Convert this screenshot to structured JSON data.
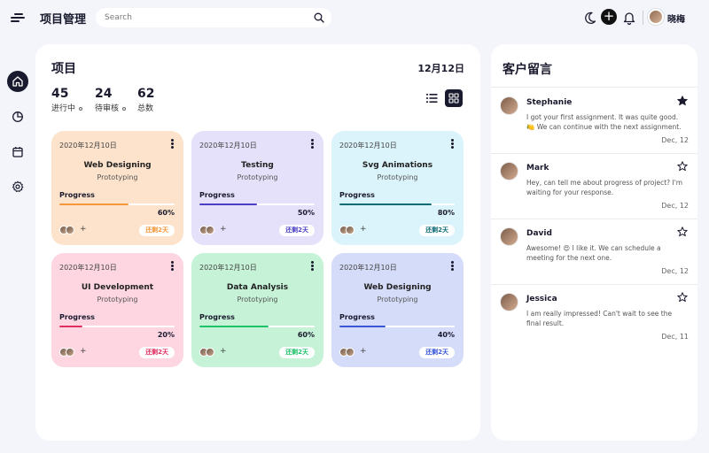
{
  "header": {
    "app_title": "项目管理",
    "search_placeholder": "Search",
    "user_name": "晓梅"
  },
  "projects": {
    "title": "项目",
    "date": "12月12日",
    "stats": [
      {
        "value": "45",
        "label": "进行中"
      },
      {
        "value": "24",
        "label": "待审核"
      },
      {
        "value": "62",
        "label": "总数"
      }
    ],
    "cards": [
      {
        "date": "2020年12月10日",
        "name": "Web Designing",
        "subtitle": "Prototyping",
        "progress_label": "Progress",
        "progress": "60%",
        "progress_value": 0.6,
        "badge": "还剩2天",
        "bg": "#fde3cb",
        "accent": "#f5973a"
      },
      {
        "date": "2020年12月10日",
        "name": "Testing",
        "subtitle": "Prototyping",
        "progress_label": "Progress",
        "progress": "50%",
        "progress_value": 0.5,
        "badge": "还剩2天",
        "bg": "#e5e1fa",
        "accent": "#4b3fc4"
      },
      {
        "date": "2020年12月10日",
        "name": "Svg Animations",
        "subtitle": "Prototyping",
        "progress_label": "Progress",
        "progress": "80%",
        "progress_value": 0.8,
        "badge": "还剩2天",
        "bg": "#dbf4fb",
        "accent": "#0d6b73"
      },
      {
        "date": "2020年12月10日",
        "name": "UI Development",
        "subtitle": "Prototyping",
        "progress_label": "Progress",
        "progress": "20%",
        "progress_value": 0.2,
        "badge": "还剩2天",
        "bg": "#fdd6e2",
        "accent": "#e02f61"
      },
      {
        "date": "2020年12月10日",
        "name": "Data Analysis",
        "subtitle": "Prototyping",
        "progress_label": "Progress",
        "progress": "60%",
        "progress_value": 0.6,
        "badge": "还剩2天",
        "bg": "#c6f3d8",
        "accent": "#1ec26a"
      },
      {
        "date": "2020年12月10日",
        "name": "Web Designing",
        "subtitle": "Prototyping",
        "progress_label": "Progress",
        "progress": "40%",
        "progress_value": 0.4,
        "badge": "还剩2天",
        "bg": "#d5dcf9",
        "accent": "#3a57d8"
      }
    ]
  },
  "messages": {
    "title": "客户留言",
    "items": [
      {
        "name": "Stephanie",
        "text": "I got your first assignment. It was quite good. 🍋 We can continue with the next assignment.",
        "time": "Dec, 12",
        "starred": true
      },
      {
        "name": "Mark",
        "text": "Hey, can tell me about progress of project? I'm waiting for your response.",
        "time": "Dec, 12",
        "starred": false
      },
      {
        "name": "David",
        "text": "Awesome! 😍 I like it. We can schedule a meeting for the next one.",
        "time": "Dec, 12",
        "starred": false
      },
      {
        "name": "Jessica",
        "text": "I am really impressed! Can't wait to see the final result.",
        "time": "Dec, 11",
        "starred": false
      }
    ]
  },
  "icons": {
    "menu": "menu-icon",
    "search": "search-icon",
    "moon": "moon-icon",
    "plus": "plus-icon",
    "bell": "bell-icon",
    "home": "home-icon",
    "chart": "pie-chart-icon",
    "calendar": "calendar-icon",
    "settings": "gear-icon",
    "list": "list-icon",
    "grid": "grid-icon",
    "more": "more-vertical-icon",
    "star": "star-icon"
  }
}
